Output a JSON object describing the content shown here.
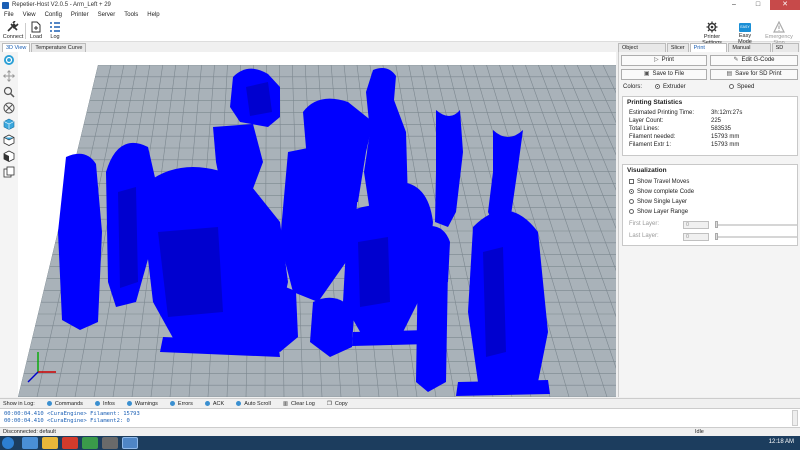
{
  "window": {
    "title": "Repetier-Host V2.0.5 - Arm_Left + 29",
    "minimize": "–",
    "maximize": "□",
    "close": "✕"
  },
  "menu": [
    "File",
    "View",
    "Config",
    "Printer",
    "Server",
    "Tools",
    "Help"
  ],
  "toolbar": {
    "connect": "Connect",
    "load": "Load",
    "log": "Log",
    "printer_settings": "Printer Settings",
    "easy_mode": "Easy Mode",
    "easy_badge": "EASY",
    "emergency_stop": "Emergency Stop"
  },
  "left_tabs": [
    "3D View",
    "Temperature Curve"
  ],
  "right_tabs": [
    "Object Placement",
    "Slicer",
    "Print Preview",
    "Manual Control",
    "SD Card"
  ],
  "preview": {
    "print": "Print",
    "edit_gcode": "Edit G-Code",
    "save_to_file": "Save to File",
    "save_sd": "Save for SD Print",
    "colors_label": "Colors:",
    "color_extruder": "Extruder",
    "color_speed": "Speed"
  },
  "stats": {
    "title": "Printing Statistics",
    "rows": [
      {
        "label": "Estimated Printing Time:",
        "value": "3h:12m:27s"
      },
      {
        "label": "Layer Count:",
        "value": "225"
      },
      {
        "label": "Total Lines:",
        "value": "583535"
      },
      {
        "label": "Filament needed:",
        "value": "15793 mm"
      },
      {
        "label": "Filament Extr 1:",
        "value": "15793 mm"
      }
    ]
  },
  "visualization": {
    "title": "Visualization",
    "show_travel": "Show Travel Moves",
    "show_complete": "Show complete Code",
    "show_single": "Show Single Layer",
    "show_range": "Show Layer Range",
    "first_layer": "First Layer:",
    "last_layer": "Last Layer:",
    "first_value": "0",
    "last_value": "0"
  },
  "log_toolbar": [
    "Show in Log:",
    "Commands",
    "Infos",
    "Warnings",
    "Errors",
    "ACK",
    "Auto Scroll",
    "Clear Log",
    "Copy"
  ],
  "log_lines": [
    "00:00:04.410 <CuraEngine> Filament: 15793",
    "00:00:04.410 <CuraEngine> Filament2: 0"
  ],
  "status": {
    "left": "Disconnected: default",
    "right": "Idle"
  },
  "taskbar": {
    "time": "12:18 AM"
  },
  "colors": {
    "model": "#0000ff",
    "grid_bg": "#a9b2b9",
    "grid_line": "#7c878f",
    "accent": "#1a5fb4"
  }
}
